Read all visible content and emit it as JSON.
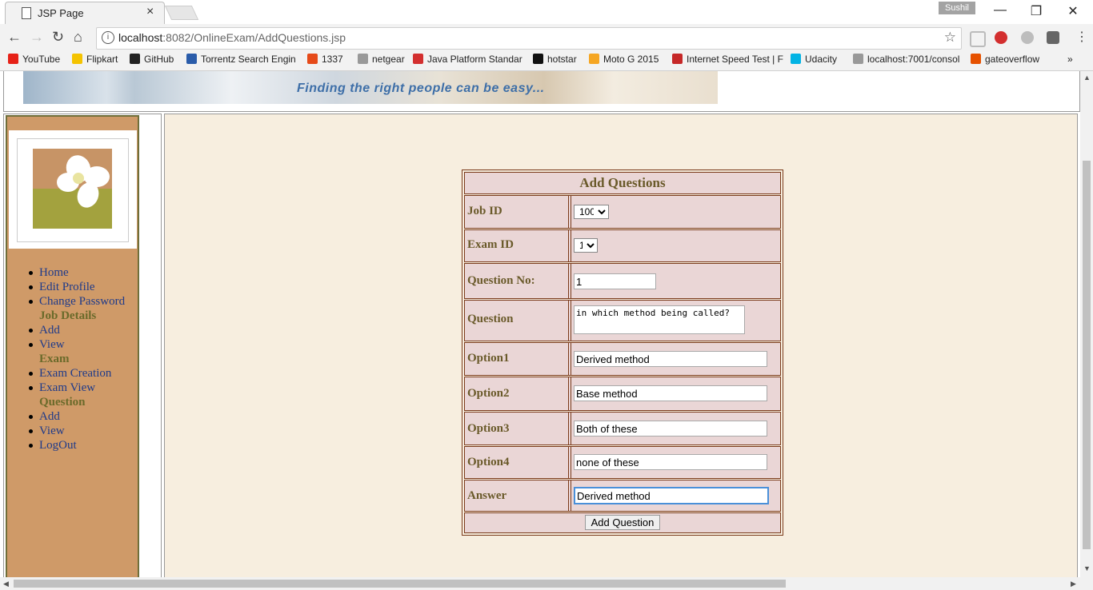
{
  "browser": {
    "tab_title": "JSP Page",
    "tab_close": "×",
    "profile_name": "Sushil",
    "window_controls": {
      "minimize": "—",
      "restore": "❐",
      "close": "✕"
    },
    "nav": {
      "back": "←",
      "forward": "→",
      "reload": "↻",
      "home": "⌂"
    },
    "url_host": "localhost",
    "url_path": ":8082/OnlineExam/AddQuestions.jsp",
    "bookmark_star": "☆",
    "bookmarks": [
      {
        "label": "YouTube",
        "color": "#e62117"
      },
      {
        "label": "Flipkart",
        "color": "#f4c300"
      },
      {
        "label": "GitHub",
        "color": "#222222"
      },
      {
        "label": "Torrentz Search Engin",
        "color": "#2a5caa"
      },
      {
        "label": "1337",
        "color": "#e64a19"
      },
      {
        "label": "netgear",
        "color": "#999999"
      },
      {
        "label": "Java Platform Standar",
        "color": "#d32f2f"
      },
      {
        "label": "hotstar",
        "color": "#111111"
      },
      {
        "label": "Moto G 2015",
        "color": "#f5a623"
      },
      {
        "label": "Internet Speed Test | F",
        "color": "#c62828"
      },
      {
        "label": "Udacity",
        "color": "#02b3e4"
      },
      {
        "label": "localhost:7001/consol",
        "color": "#999999"
      },
      {
        "label": "gateoverflow",
        "color": "#e65100"
      }
    ],
    "bookmarks_overflow": "»"
  },
  "banner": {
    "tagline": "Finding the right people can be easy..."
  },
  "sidebar": {
    "menu": [
      {
        "type": "link",
        "label": "Home"
      },
      {
        "type": "link",
        "label": "Edit Profile"
      },
      {
        "type": "link",
        "label": "Change Password"
      },
      {
        "type": "heading",
        "label": "Job Details"
      },
      {
        "type": "link",
        "label": "Add"
      },
      {
        "type": "link",
        "label": "View"
      },
      {
        "type": "heading",
        "label": "Exam"
      },
      {
        "type": "link",
        "label": "Exam Creation"
      },
      {
        "type": "link",
        "label": "Exam View"
      },
      {
        "type": "heading",
        "label": "Question"
      },
      {
        "type": "link",
        "label": "Add"
      },
      {
        "type": "link",
        "label": "View"
      },
      {
        "type": "link",
        "label": "LogOut"
      }
    ]
  },
  "form": {
    "title": "Add Questions",
    "job_id": {
      "label": "Job ID",
      "selected": "100"
    },
    "exam_id": {
      "label": "Exam ID",
      "selected": "1"
    },
    "question_no": {
      "label": "Question No:",
      "value": "1"
    },
    "question": {
      "label": "Question",
      "value": "in which method being called?"
    },
    "option1": {
      "label": "Option1",
      "value": "Derived method"
    },
    "option2": {
      "label": "Option2",
      "value": "Base method"
    },
    "option3": {
      "label": "Option3",
      "value": "Both of these"
    },
    "option4": {
      "label": "Option4",
      "value": "none of these"
    },
    "answer": {
      "label": "Answer",
      "value": "Derived method"
    },
    "submit_label": "Add Question"
  }
}
